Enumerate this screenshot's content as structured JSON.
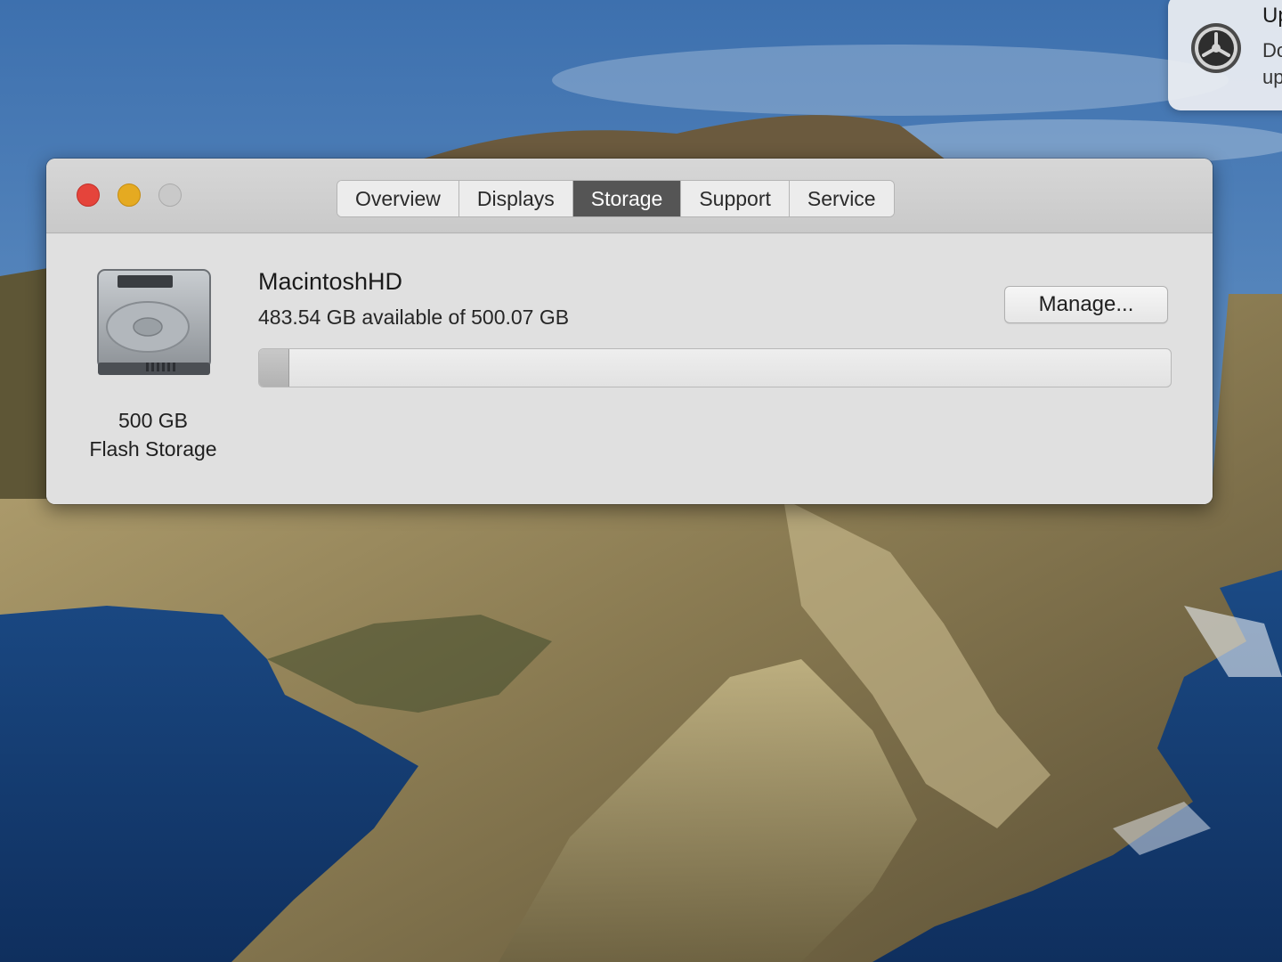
{
  "window": {
    "tabs": [
      {
        "label": "Overview"
      },
      {
        "label": "Displays"
      },
      {
        "label": "Storage",
        "active": true
      },
      {
        "label": "Support"
      },
      {
        "label": "Service"
      }
    ]
  },
  "storage": {
    "disk_size": "500 GB",
    "disk_type": "Flash Storage",
    "volume_name": "MacintoshHD",
    "available_text": "483.54 GB available of 500.07 GB",
    "used_fraction": 0.033,
    "manage_label": "Manage..."
  },
  "notification": {
    "title": "Up",
    "body_line1": "Do",
    "body_line2": "up",
    "icon": "gear-icon"
  },
  "colors": {
    "close": "#e5443b",
    "minimize": "#e5aa21",
    "zoom_disabled": "#c9c9c9",
    "active_tab": "#555555"
  }
}
